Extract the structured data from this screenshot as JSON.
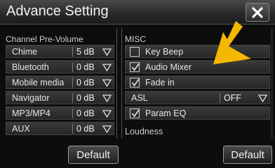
{
  "window": {
    "title": "Advance Setting"
  },
  "left_panel": {
    "header": "Channel Pre-Volume",
    "rows": [
      {
        "label": "Chime",
        "value": "5 dB"
      },
      {
        "label": "Bluetooth",
        "value": "0 dB"
      },
      {
        "label": "Mobile media",
        "value": "0 dB"
      },
      {
        "label": "Navigator",
        "value": "0 dB"
      },
      {
        "label": "MP3/MP4",
        "value": "0 dB"
      },
      {
        "label": "AUX",
        "value": "0 dB"
      }
    ],
    "default_label": "Default"
  },
  "right_panel": {
    "header": "MISC",
    "items": [
      {
        "label": "Key Beep",
        "checked": false
      },
      {
        "label": "Audio Mixer",
        "checked": true
      },
      {
        "label": "Fade in",
        "checked": true
      }
    ],
    "asl": {
      "label": "ASL",
      "value": "OFF"
    },
    "param_eq": {
      "label": "Param EQ",
      "checked": true
    },
    "loudness_label": "Loudness",
    "default_label": "Default"
  },
  "colors": {
    "pointer": "#f5b800",
    "background": "#0d0d0d"
  },
  "icons": {
    "close": "close-icon",
    "dropdown": "triangle-down-icon",
    "check": "check-icon"
  }
}
